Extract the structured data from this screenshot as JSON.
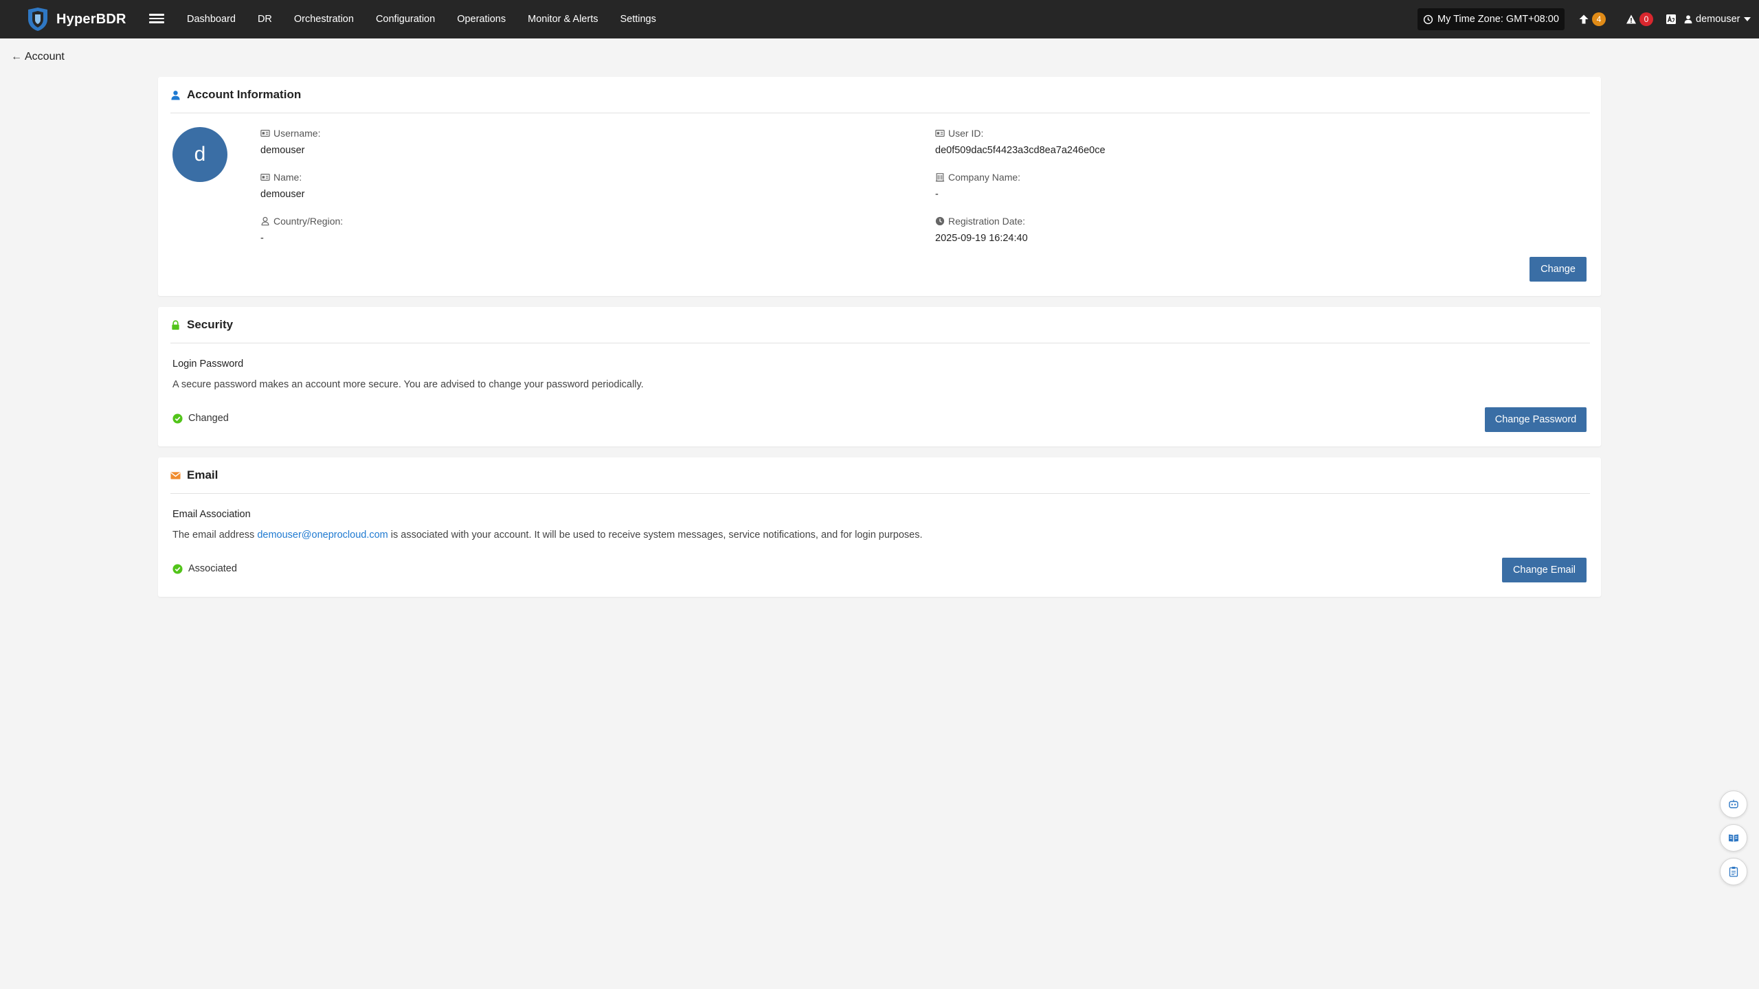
{
  "app": {
    "brand": "HyperBDR"
  },
  "nav": {
    "items": [
      "Dashboard",
      "DR",
      "Orchestration",
      "Configuration",
      "Operations",
      "Monitor & Alerts",
      "Settings"
    ]
  },
  "topbar": {
    "timezone": "My Time Zone: GMT+08:00",
    "upgrade_count": "4",
    "alert_count": "0",
    "username": "demouser",
    "colors": {
      "upgrade_badge": "#e08b17",
      "alert_badge": "#d9272e"
    }
  },
  "page": {
    "back_label": "Account"
  },
  "account": {
    "title": "Account Information",
    "avatar_letter": "d",
    "username_label": "Username:",
    "username": "demouser",
    "name_label": "Name:",
    "name": "demouser",
    "country_label": "Country/Region:",
    "country": "-",
    "userid_label": "User ID:",
    "userid": "de0f509dac5f4423a3cd8ea7a246e0ce",
    "company_label": "Company Name:",
    "company": "-",
    "regdate_label": "Registration Date:",
    "regdate": "2025-09-19 16:24:40",
    "change_button": "Change"
  },
  "security": {
    "title": "Security",
    "subtitle": "Login Password",
    "description": "A secure password makes an account more secure. You are advised to change your password periodically.",
    "status": "Changed",
    "button": "Change Password"
  },
  "email": {
    "title": "Email",
    "subtitle": "Email Association",
    "desc_prefix": "The email address ",
    "address": "demouser@oneprocloud.com",
    "desc_suffix": " is associated with your account. It will be used to receive system messages, service notifications, and for login purposes.",
    "status": "Associated",
    "button": "Change Email"
  },
  "colors": {
    "primary": "#3a6ea5",
    "success": "#52c41a",
    "link": "#1f7ad1",
    "topbar": "#262626"
  }
}
